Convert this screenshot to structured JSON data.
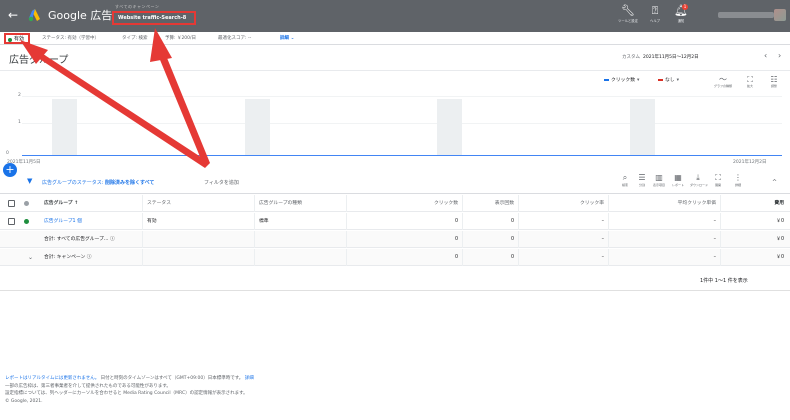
{
  "topbar": {
    "back_icon": "←",
    "brand": "Google 広告",
    "campaign_sub": "すべてのキャンペーン",
    "campaign_name": "Website traffic-Search-8",
    "tools": [
      {
        "icon": "wrench-icon",
        "label": "ツールと設定"
      },
      {
        "icon": "help-icon",
        "label": "ヘルプ"
      },
      {
        "icon": "bell-icon",
        "label": "通知",
        "badge": "1"
      }
    ]
  },
  "statusbar": {
    "status": "有効",
    "status_detail": "ステータス: 有効（学習中）",
    "type": "タイプ: 検索",
    "budget": "予算: ￥200/日",
    "score": "最適化スコア: --",
    "details": "詳細 ⌄"
  },
  "page": {
    "title": "広告グループ",
    "date_prefix": "カスタム",
    "date_range": "2021年11月5日〜12月2日",
    "date_prev": "‹",
    "date_next": "›"
  },
  "chart_data": {
    "type": "line",
    "series": [
      {
        "name": "クリック数",
        "color": "#1a73e8",
        "values": [
          0,
          0
        ]
      },
      {
        "name": "なし",
        "color": "#d93025",
        "values": []
      }
    ],
    "x": [
      "2021年11月5日",
      "2021年12月2日"
    ],
    "yticks": [
      "2",
      "1",
      "0"
    ],
    "ylim": [
      0,
      2
    ],
    "tools": [
      {
        "icon": "chart-type-icon",
        "label": "グラフの種類"
      },
      {
        "icon": "expand-icon",
        "label": "拡大"
      },
      {
        "icon": "settings-icon",
        "label": "調整"
      }
    ]
  },
  "filter": {
    "status_filter_label": "広告グループのステータス:",
    "status_filter_value": "削除済みを除くすべて",
    "add_filter": "フィルタを追加",
    "tools": [
      {
        "label": "検索"
      },
      {
        "label": "分割"
      },
      {
        "label": "表示項目"
      },
      {
        "label": "レポート"
      },
      {
        "label": "ダウンロード"
      },
      {
        "label": "展開"
      },
      {
        "label": "詳細"
      }
    ],
    "collapse_icon": "^"
  },
  "table": {
    "headers": [
      "広告グループ ↑",
      "ステータス",
      "広告グループの種類",
      "クリック数",
      "表示回数",
      "クリック率",
      "平均クリック単価",
      "費用"
    ],
    "rows": [
      {
        "name": "広告グループ1 個",
        "status": "有効",
        "type": "標準",
        "clicks": "0",
        "impressions": "0",
        "ctr": "–",
        "cpc": "–",
        "cost": "￥0"
      }
    ],
    "totals": [
      {
        "label": "合計: すべての広告グループ... ⓘ",
        "clicks": "0",
        "impressions": "0",
        "ctr": "–",
        "cpc": "–",
        "cost": "￥0"
      },
      {
        "label": "合計: キャンペーン ⓘ",
        "clicks": "0",
        "impressions": "0",
        "ctr": "–",
        "cpc": "–",
        "cost": "￥0"
      }
    ],
    "pagination": "1件中 1〜1 件を表示"
  },
  "footer": {
    "line1_link": "レポートはリアルタイムには更新されません。",
    "line1_rest": "日付と時刻のタイムゾーンはすべて（GMT+09:00）日本標準時です。",
    "line1_more": "詳細",
    "line2": "一部の広告枠は、第三者事業者を介して提供されたものである可能性があります。",
    "line3": "設定指標については、列ヘッダーにカーソルを合わせると Media Rating Council（MRC）の認定情報が表示されます。",
    "line4": "© Google, 2021."
  },
  "colors": {
    "topbar": "#5f6368",
    "accent": "#1a73e8",
    "highlight": "#e53935",
    "active": "#1e8e3e"
  }
}
